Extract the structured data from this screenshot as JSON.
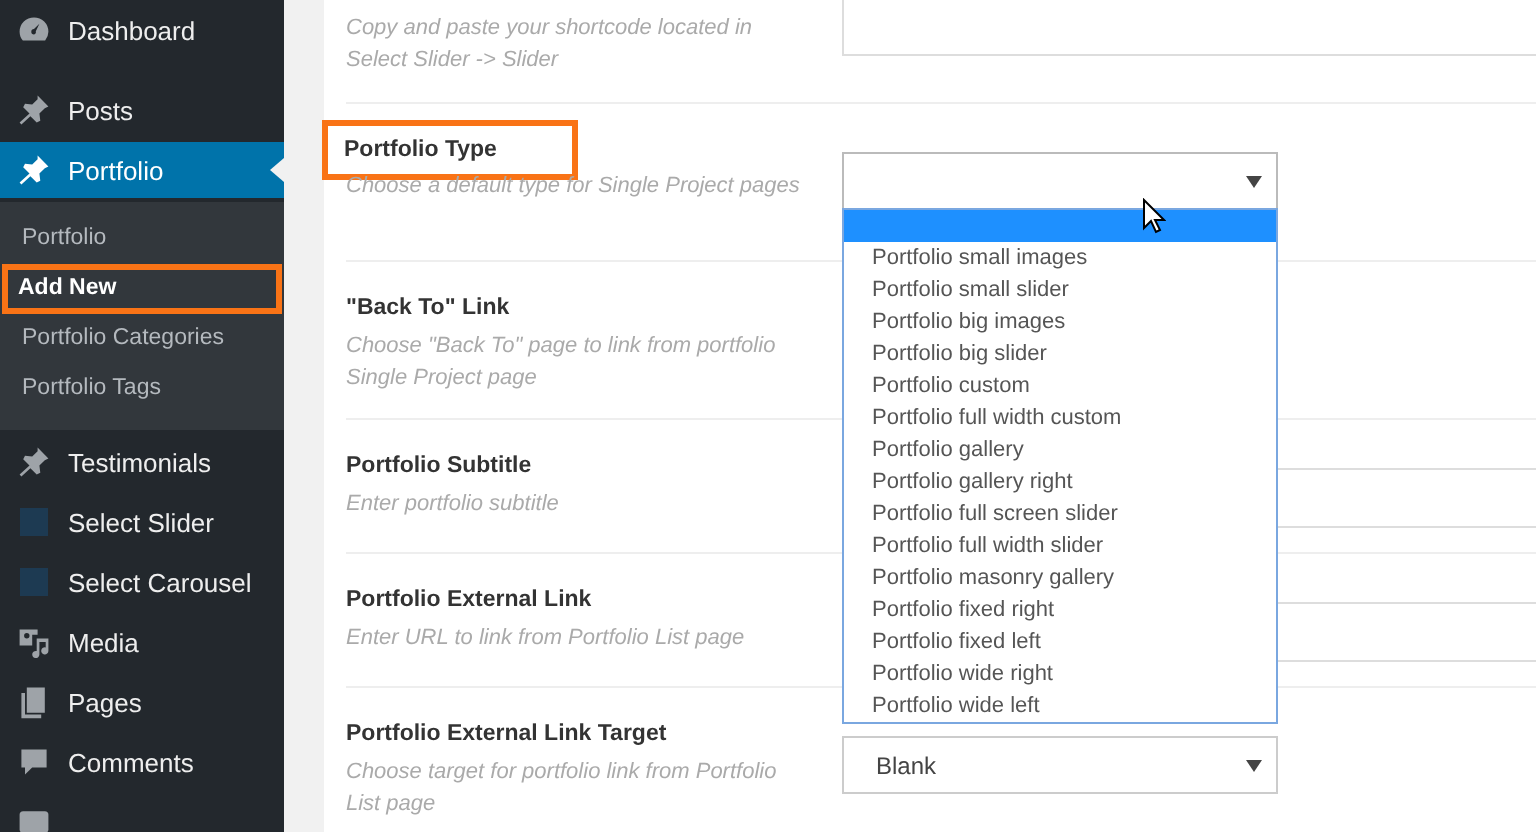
{
  "sidebar": {
    "items": [
      {
        "label": "Dashboard",
        "selected": false
      },
      {
        "label": "Posts",
        "selected": false
      },
      {
        "label": "Portfolio",
        "selected": true,
        "children": [
          {
            "label": "Portfolio",
            "selected": false,
            "highlighted": false
          },
          {
            "label": "Add New",
            "selected": true,
            "highlighted": true
          },
          {
            "label": "Portfolio Categories",
            "selected": false,
            "highlighted": false
          },
          {
            "label": "Portfolio Tags",
            "selected": false,
            "highlighted": false
          }
        ]
      },
      {
        "label": "Testimonials",
        "selected": false
      },
      {
        "label": "Select Slider",
        "selected": false
      },
      {
        "label": "Select Carousel",
        "selected": false
      },
      {
        "label": "Media",
        "selected": false
      },
      {
        "label": "Pages",
        "selected": false
      },
      {
        "label": "Comments",
        "selected": false
      }
    ]
  },
  "fields": [
    {
      "description": "Copy and paste your shortcode located in Select Slider -> Slider",
      "control": {
        "kind": "text"
      }
    },
    {
      "label": "Portfolio Type",
      "description": "Choose a default type for Single Project pages",
      "highlighted": true,
      "control": {
        "kind": "select",
        "expanded": true,
        "options": [
          {
            "selected": true
          },
          {
            "label": "Portfolio small images",
            "selected": false
          },
          {
            "label": "Portfolio small slider",
            "selected": false
          },
          {
            "label": "Portfolio big images",
            "selected": false
          },
          {
            "label": "Portfolio big slider",
            "selected": false
          },
          {
            "label": "Portfolio custom",
            "selected": false
          },
          {
            "label": "Portfolio full width custom",
            "selected": false
          },
          {
            "label": "Portfolio gallery",
            "selected": false
          },
          {
            "label": "Portfolio gallery right",
            "selected": false
          },
          {
            "label": "Portfolio full screen slider",
            "selected": false
          },
          {
            "label": "Portfolio full width slider",
            "selected": false
          },
          {
            "label": "Portfolio masonry gallery",
            "selected": false
          },
          {
            "label": "Portfolio fixed right",
            "selected": false
          },
          {
            "label": "Portfolio fixed left",
            "selected": false
          },
          {
            "label": "Portfolio wide right",
            "selected": false
          },
          {
            "label": "Portfolio wide left",
            "selected": false
          }
        ]
      }
    },
    {
      "label": "\"Back To\" Link",
      "description": "Choose \"Back To\" page to link from portfolio Single Project page",
      "highlighted": false
    },
    {
      "label": "Portfolio Subtitle",
      "description": "Enter portfolio subtitle",
      "highlighted": false,
      "control": {
        "kind": "text"
      }
    },
    {
      "label": "Portfolio External Link",
      "description": "Enter URL to link from Portfolio List page",
      "highlighted": false,
      "control": {
        "kind": "text"
      }
    },
    {
      "label": "Portfolio External Link Target",
      "description": "Choose target for portfolio link from Portfolio List page",
      "highlighted": false,
      "control": {
        "kind": "select",
        "value": "Blank",
        "expanded": false
      }
    }
  ]
}
